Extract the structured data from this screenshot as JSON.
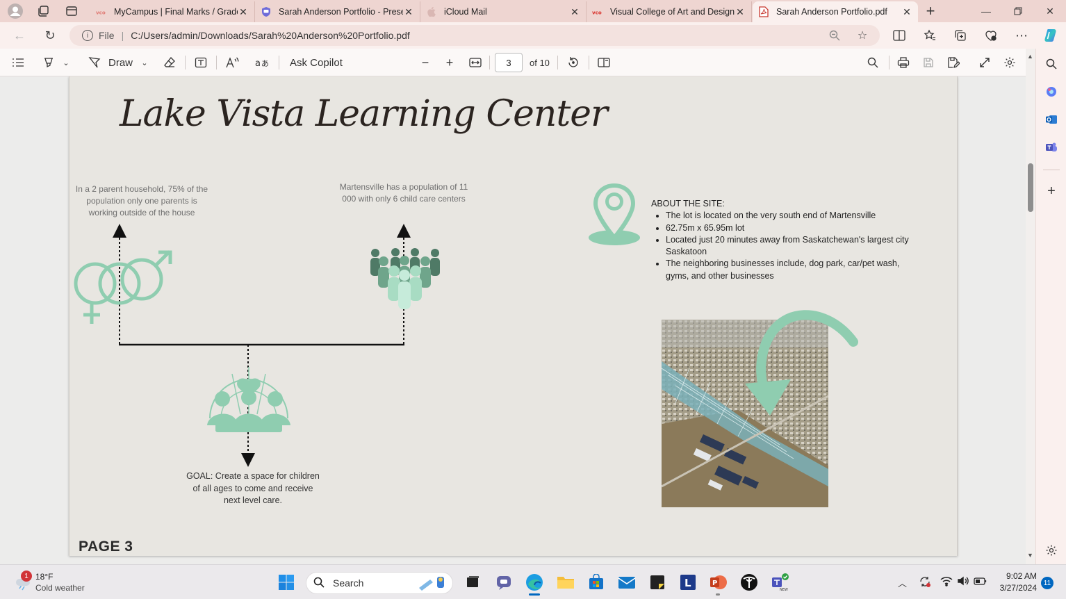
{
  "tabs": [
    {
      "label": "MyCampus | Final Marks / Grade",
      "favicon": "vco-icon",
      "active": false
    },
    {
      "label": "Sarah Anderson Portfolio - Prese",
      "favicon": "shield-chat-icon",
      "active": false
    },
    {
      "label": "iCloud Mail",
      "favicon": "apple-icon",
      "active": false
    },
    {
      "label": "Visual College of Art and Design",
      "favicon": "vco-icon",
      "active": false
    },
    {
      "label": "Sarah Anderson Portfolio.pdf",
      "favicon": "pdf-icon",
      "active": true
    }
  ],
  "address": {
    "scheme_label": "File",
    "url": "C:/Users/admin/Downloads/Sarah%20Anderson%20Portfolio.pdf"
  },
  "pdf_toolbar": {
    "draw_label": "Draw",
    "copilot_label": "Ask Copilot",
    "current_page": "3",
    "page_total": "of 10"
  },
  "document": {
    "title": "Lake Vista Learning Center",
    "stat_household": "In a 2 parent household, 75% of the population only one parents is working outside of the house",
    "stat_population": "Martensville has a population of 11 000 with only 6 child care centers",
    "goal": "GOAL: Create a space for children of all ages to come and receive next level care.",
    "about_heading": "ABOUT THE SITE:",
    "about_items": [
      "The lot is located on the very south end of Martensville",
      "62.75m x 65.95m lot",
      "Located just 20 minutes away from Saskatchewan's largest city Saskatoon",
      "The neighboring businesses include, dog park, car/pet wash, gyms, and other businesses"
    ],
    "page_label": "PAGE 3",
    "accent_color": "#8fcdb0"
  },
  "taskbar": {
    "weather_temp": "18°F",
    "weather_desc": "Cold weather",
    "weather_badge": "1",
    "search_label": "Search",
    "time": "9:02 AM",
    "date": "3/27/2024",
    "notif_count": "11"
  }
}
